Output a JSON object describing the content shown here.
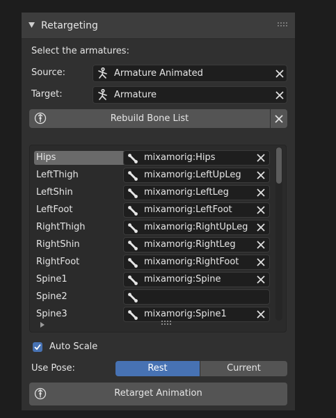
{
  "panel": {
    "title": "Retargeting",
    "select_label": "Select the armatures:"
  },
  "source": {
    "label": "Source:",
    "value": "Armature Animated"
  },
  "target": {
    "label": "Target:",
    "value": "Armature"
  },
  "rebuild_button": {
    "label": "Rebuild Bone List"
  },
  "bones": [
    {
      "name": "Hips",
      "value": "mixamorig:Hips",
      "selected": true
    },
    {
      "name": "LeftThigh",
      "value": "mixamorig:LeftUpLeg"
    },
    {
      "name": "LeftShin",
      "value": "mixamorig:LeftLeg"
    },
    {
      "name": "LeftFoot",
      "value": "mixamorig:LeftFoot"
    },
    {
      "name": "RightThigh",
      "value": "mixamorig:RightUpLeg"
    },
    {
      "name": "RightShin",
      "value": "mixamorig:RightLeg"
    },
    {
      "name": "RightFoot",
      "value": "mixamorig:RightFoot"
    },
    {
      "name": "Spine1",
      "value": "mixamorig:Spine"
    },
    {
      "name": "Spine2",
      "value": ""
    },
    {
      "name": "Spine3",
      "value": "mixamorig:Spine1"
    }
  ],
  "auto_scale": {
    "label": "Auto Scale",
    "checked": true
  },
  "use_pose": {
    "label": "Use Pose:",
    "options": [
      "Rest",
      "Current"
    ],
    "selected": "Rest"
  },
  "retarget_button": {
    "label": "Retarget Animation"
  },
  "colors": {
    "accent": "#4772b3",
    "panel": "#303030",
    "field": "#1e1e1e",
    "button": "#545454"
  }
}
